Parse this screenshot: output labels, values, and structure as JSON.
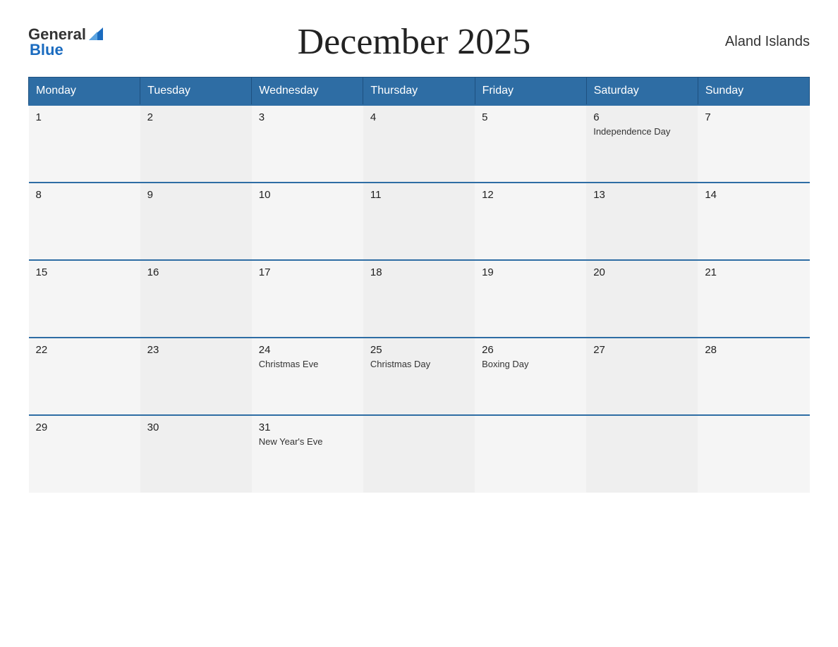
{
  "header": {
    "logo_general": "General",
    "logo_blue": "Blue",
    "title": "December 2025",
    "region": "Aland Islands"
  },
  "calendar": {
    "days_of_week": [
      "Monday",
      "Tuesday",
      "Wednesday",
      "Thursday",
      "Friday",
      "Saturday",
      "Sunday"
    ],
    "weeks": [
      [
        {
          "day": "1",
          "holiday": ""
        },
        {
          "day": "2",
          "holiday": ""
        },
        {
          "day": "3",
          "holiday": ""
        },
        {
          "day": "4",
          "holiday": ""
        },
        {
          "day": "5",
          "holiday": ""
        },
        {
          "day": "6",
          "holiday": "Independence Day"
        },
        {
          "day": "7",
          "holiday": ""
        }
      ],
      [
        {
          "day": "8",
          "holiday": ""
        },
        {
          "day": "9",
          "holiday": ""
        },
        {
          "day": "10",
          "holiday": ""
        },
        {
          "day": "11",
          "holiday": ""
        },
        {
          "day": "12",
          "holiday": ""
        },
        {
          "day": "13",
          "holiday": ""
        },
        {
          "day": "14",
          "holiday": ""
        }
      ],
      [
        {
          "day": "15",
          "holiday": ""
        },
        {
          "day": "16",
          "holiday": ""
        },
        {
          "day": "17",
          "holiday": ""
        },
        {
          "day": "18",
          "holiday": ""
        },
        {
          "day": "19",
          "holiday": ""
        },
        {
          "day": "20",
          "holiday": ""
        },
        {
          "day": "21",
          "holiday": ""
        }
      ],
      [
        {
          "day": "22",
          "holiday": ""
        },
        {
          "day": "23",
          "holiday": ""
        },
        {
          "day": "24",
          "holiday": "Christmas Eve"
        },
        {
          "day": "25",
          "holiday": "Christmas Day"
        },
        {
          "day": "26",
          "holiday": "Boxing Day"
        },
        {
          "day": "27",
          "holiday": ""
        },
        {
          "day": "28",
          "holiday": ""
        }
      ],
      [
        {
          "day": "29",
          "holiday": ""
        },
        {
          "day": "30",
          "holiday": ""
        },
        {
          "day": "31",
          "holiday": "New Year's Eve"
        },
        {
          "day": "",
          "holiday": ""
        },
        {
          "day": "",
          "holiday": ""
        },
        {
          "day": "",
          "holiday": ""
        },
        {
          "day": "",
          "holiday": ""
        }
      ]
    ]
  }
}
